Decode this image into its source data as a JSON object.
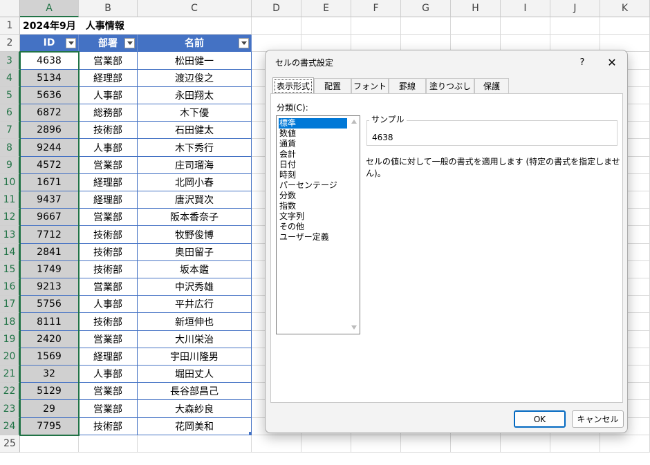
{
  "columns": [
    "A",
    "B",
    "C",
    "D",
    "E",
    "F",
    "G",
    "H",
    "I",
    "J",
    "K"
  ],
  "rows": [
    "1",
    "2",
    "3",
    "4",
    "5",
    "6",
    "7",
    "8",
    "9",
    "10",
    "11",
    "12",
    "13",
    "14",
    "15",
    "16",
    "17",
    "18",
    "19",
    "20",
    "21",
    "22",
    "23",
    "24",
    "25"
  ],
  "sheet_title": "2024年9月　人事情報",
  "table_headers": [
    "ID",
    "部署",
    "名前"
  ],
  "table_rows": [
    [
      "4638",
      "営業部",
      "松田健一"
    ],
    [
      "5134",
      "経理部",
      "渡辺俊之"
    ],
    [
      "5636",
      "人事部",
      "永田翔太"
    ],
    [
      "6872",
      "総務部",
      "木下優"
    ],
    [
      "2896",
      "技術部",
      "石田健太"
    ],
    [
      "9244",
      "人事部",
      "木下秀行"
    ],
    [
      "4572",
      "営業部",
      "庄司瑠海"
    ],
    [
      "1671",
      "経理部",
      "北岡小春"
    ],
    [
      "9437",
      "経理部",
      "唐沢賢次"
    ],
    [
      "9667",
      "営業部",
      "阪本香奈子"
    ],
    [
      "7712",
      "技術部",
      "牧野俊博"
    ],
    [
      "2841",
      "技術部",
      "奥田留子"
    ],
    [
      "1749",
      "技術部",
      "坂本鑑"
    ],
    [
      "9213",
      "営業部",
      "中沢秀雄"
    ],
    [
      "5756",
      "人事部",
      "平井広行"
    ],
    [
      "8111",
      "技術部",
      "新垣伸也"
    ],
    [
      "2420",
      "営業部",
      "大川栄治"
    ],
    [
      "1569",
      "経理部",
      "宇田川隆男"
    ],
    [
      "32",
      "人事部",
      "堀田丈人"
    ],
    [
      "5129",
      "営業部",
      "長谷部昌己"
    ],
    [
      "29",
      "営業部",
      "大森紗良"
    ],
    [
      "7795",
      "技術部",
      "花岡美和"
    ]
  ],
  "dialog": {
    "title": "セルの書式設定",
    "help": "?",
    "close": "✕",
    "tabs": [
      "表示形式",
      "配置",
      "フォント",
      "罫線",
      "塗りつぶし",
      "保護"
    ],
    "category_label": "分類(C):",
    "categories": [
      "標準",
      "数値",
      "通貨",
      "会計",
      "日付",
      "時刻",
      "パーセンテージ",
      "分数",
      "指数",
      "文字列",
      "その他",
      "ユーザー定義"
    ],
    "selected_category": "標準",
    "sample_label": "サンプル",
    "sample_value": "4638",
    "description": "セルの値に対して一般の書式を適用します (特定の書式を指定しません)。",
    "ok": "OK",
    "cancel": "キャンセル"
  },
  "colors": {
    "table_header": "#4472c4",
    "selection": "#217346",
    "list_selected": "#0078d7"
  }
}
